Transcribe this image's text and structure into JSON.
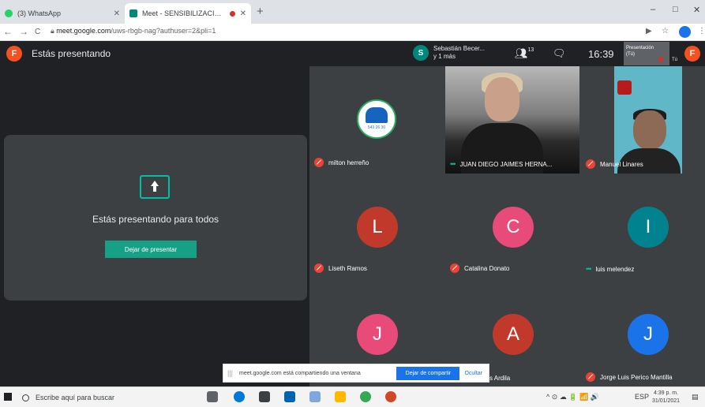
{
  "browser": {
    "tabs": [
      {
        "label": "(3) WhatsApp",
        "favicon_color": "#25d366"
      },
      {
        "label": "Meet - SENSIBILIZACION SI",
        "favicon_color": "#00897b"
      }
    ],
    "new_tab": "+",
    "window_controls": {
      "minimize": "–",
      "maximize": "□",
      "close": "✕"
    },
    "nav": {
      "back": "←",
      "forward": "→",
      "reload": "C"
    },
    "url_host": "meet.google.com",
    "url_path": "/uws-rbgb-nag?authuser=2&pli=1",
    "icons": [
      "cast-icon",
      "star-icon",
      "profile-icon",
      "menu-icon"
    ]
  },
  "meet": {
    "self_initial": "F",
    "header_title": "Estás presentando",
    "presenter": {
      "initial": "S",
      "line1": "Sebastián Becer...",
      "line2": "y 1 más"
    },
    "participants_count": "13",
    "time": "16:39",
    "presentation_thumb": {
      "line1": "Presentación",
      "line2": "(Tú)",
      "you": "Tú"
    },
    "present_card": {
      "message": "Estás presentando para todos",
      "stop_button": "Dejar de presentar"
    },
    "tiles": [
      {
        "name": "milton herreño",
        "type": "logo",
        "logo_text": "543 26 30",
        "status": "muted"
      },
      {
        "name": "JUAN DIEGO JAIMES HERNA...",
        "type": "video",
        "status": "speaking"
      },
      {
        "name": "Manuel Linares",
        "type": "video",
        "status": "muted"
      },
      {
        "name": "Liseth Ramos",
        "initial": "L",
        "color": "#c0392b",
        "status": "muted"
      },
      {
        "name": "Catalina Donato",
        "initial": "C",
        "color": "#e84a7a",
        "status": "muted"
      },
      {
        "name": "luis melendez",
        "initial": "I",
        "color": "#00838f",
        "status": "speaking"
      },
      {
        "name": "",
        "initial": "J",
        "color": "#e84a7a",
        "status": "none"
      },
      {
        "name": "s Ardila",
        "initial": "A",
        "color": "#c0392b",
        "status": "none"
      },
      {
        "name": "Jorge Luis Perico Mantilla",
        "initial": "J",
        "color": "#1a73e8",
        "status": "muted"
      }
    ],
    "share_notice": {
      "grip": "|||",
      "text": "meet.google.com está compartiendo una ventana",
      "stop_button": "Dejar de compartir",
      "hide_button": "Ocultar"
    }
  },
  "taskbar": {
    "search_placeholder": "Escribe aquí para buscar",
    "tray_text": "ESP",
    "time": "4:39 p. m.",
    "date": "31/01/2021",
    "tray_icons": "^ ⊙ ☁ 🔋 📶 🔊"
  }
}
